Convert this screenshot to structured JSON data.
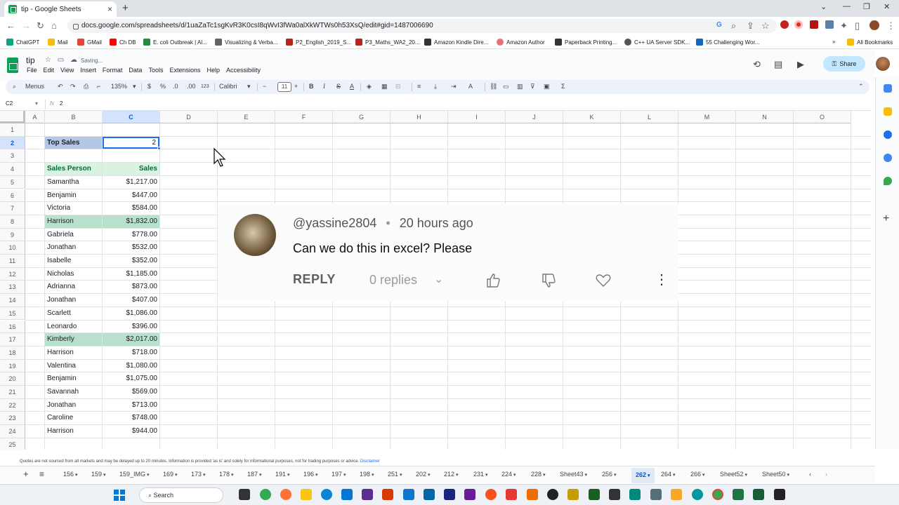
{
  "browser": {
    "tab_title": "tip - Google Sheets",
    "url": "docs.google.com/spreadsheets/d/1uaZaTc1sgKvR3K0csI8qWvI3fWa0alXkWTWs0h53XsQ/edit#gid=1487006690",
    "bookmarks": [
      "ChatGPT",
      "Mail",
      "GMail",
      "Ch DB",
      "E. coli Outbreak | Al...",
      "Visualizing & Verba...",
      "P2_English_2019_S...",
      "P3_Maths_WA2_20...",
      "Amazon Kindle Dire...",
      "Amazon Author",
      "Paperback Printing...",
      "C++ UA Server SDK...",
      "55 Challenging Wor..."
    ],
    "all_bookmarks": "All Bookmarks"
  },
  "sheets": {
    "doc_title": "tip",
    "saving": "Saving...",
    "menus": [
      "File",
      "Edit",
      "View",
      "Insert",
      "Format",
      "Data",
      "Tools",
      "Extensions",
      "Help",
      "Accessibility"
    ],
    "share": "Share",
    "toolbar": {
      "menus_label": "Menus",
      "zoom": "135%",
      "currency": "$",
      "percent": "%",
      "dec_less": ".0",
      "dec_more": ".00",
      "format_123": "123",
      "font": "Calibri",
      "font_size": "11"
    },
    "name_box": "C2",
    "fx": "fx",
    "formula_value": "2"
  },
  "grid": {
    "columns": [
      "A",
      "B",
      "C",
      "D",
      "E",
      "F",
      "G",
      "H",
      "I",
      "J",
      "K",
      "L",
      "M",
      "N",
      "O"
    ],
    "rows": [
      "1",
      "2",
      "3",
      "4",
      "5",
      "6",
      "7",
      "8",
      "9",
      "10",
      "11",
      "12",
      "13",
      "14",
      "15",
      "16",
      "17",
      "18",
      "19",
      "20",
      "21",
      "22",
      "23",
      "24",
      "25"
    ],
    "top_sales_label": "Top Sales",
    "top_sales_value": "2",
    "header_person": "Sales Person",
    "header_sales": "Sales",
    "data": [
      {
        "name": "Samantha",
        "sales": "$1,217.00",
        "hl": false
      },
      {
        "name": "Benjamin",
        "sales": "$447.00",
        "hl": false
      },
      {
        "name": "Victoria",
        "sales": "$584.00",
        "hl": false
      },
      {
        "name": "Harrison",
        "sales": "$1,832.00",
        "hl": true
      },
      {
        "name": "Gabriela",
        "sales": "$778.00",
        "hl": false
      },
      {
        "name": "Jonathan",
        "sales": "$532.00",
        "hl": false
      },
      {
        "name": "Isabelle",
        "sales": "$352.00",
        "hl": false
      },
      {
        "name": "Nicholas",
        "sales": "$1,185.00",
        "hl": false
      },
      {
        "name": "Adrianna",
        "sales": "$873.00",
        "hl": false
      },
      {
        "name": "Jonathan",
        "sales": "$407.00",
        "hl": false
      },
      {
        "name": "Scarlett",
        "sales": "$1,086.00",
        "hl": false
      },
      {
        "name": "Leonardo",
        "sales": "$396.00",
        "hl": false
      },
      {
        "name": "Kimberly",
        "sales": "$2,017.00",
        "hl": true
      },
      {
        "name": "Harrison",
        "sales": "$718.00",
        "hl": false
      },
      {
        "name": "Valentina",
        "sales": "$1,080.00",
        "hl": false
      },
      {
        "name": "Benjamin",
        "sales": "$1,075.00",
        "hl": false
      },
      {
        "name": "Savannah",
        "sales": "$569.00",
        "hl": false
      },
      {
        "name": "Jonathan",
        "sales": "$713.00",
        "hl": false
      },
      {
        "name": "Caroline",
        "sales": "$748.00",
        "hl": false
      },
      {
        "name": "Harrison",
        "sales": "$944.00",
        "hl": false
      }
    ]
  },
  "comment": {
    "user": "@yassine2804",
    "time": "20 hours ago",
    "text": "Can we do this in excel? Please",
    "reply": "REPLY",
    "replies": "0 replies"
  },
  "disclaimer": "Quotes are not sourced from all markets and may be delayed up to 20 minutes. Information is provided 'as is' and solely for informational purposes, not for trading purposes or advice.",
  "disclaimer_link": "Disclaimer",
  "sheet_tabs": [
    "156",
    "159",
    "159_IMG",
    "169",
    "173",
    "178",
    "187",
    "191",
    "196",
    "197",
    "198",
    "251",
    "202",
    "212",
    "231",
    "224",
    "228",
    "Sheet43",
    "256",
    "262",
    "264",
    "266",
    "Sheet52",
    "Sheet50"
  ],
  "active_sheet": "262",
  "taskbar": {
    "search": "Search"
  },
  "colors": {
    "accent": "#1a73e8",
    "highlight": "#b7e1cd",
    "header_fill": "#d9f2e3",
    "top_sales_fill": "#b4c7e7"
  }
}
